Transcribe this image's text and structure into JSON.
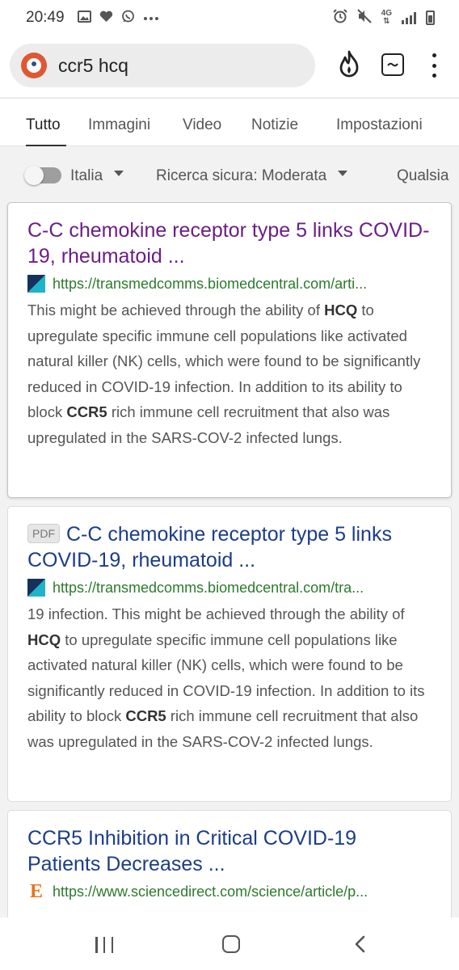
{
  "status_bar": {
    "time": "20:49",
    "network": "4G"
  },
  "search": {
    "query": "ccr5 hcq"
  },
  "tabs": [
    {
      "label": "Tutto",
      "active": true
    },
    {
      "label": "Immagini",
      "active": false
    },
    {
      "label": "Video",
      "active": false
    },
    {
      "label": "Notizie",
      "active": false
    },
    {
      "label": "Impostazioni",
      "active": false
    }
  ],
  "filters": {
    "region_label": "Italia",
    "safe_search_label": "Ricerca sicura: Moderata",
    "time_label": "Qualsia"
  },
  "results": [
    {
      "title": "C-C chemokine receptor type 5 links COVID-19, rheumatoid ...",
      "url": "https://transmedcomms.biomedcentral.com/arti...",
      "favicon": "bmc-icon",
      "visited": true,
      "snippet_parts": [
        {
          "t": "This might be achieved through the ability of ",
          "b": false
        },
        {
          "t": "HCQ",
          "b": true
        },
        {
          "t": " to upregulate specific immune cell populations like activated natural killer (NK) cells, which were found to be significantly reduced in COVID-19 infection. In addition to its ability to block ",
          "b": false
        },
        {
          "t": "CCR5",
          "b": true
        },
        {
          "t": " rich immune cell recruitment that also was upregulated in the SARS-COV-2 infected lungs.",
          "b": false
        }
      ]
    },
    {
      "badge": "PDF",
      "title": "C-C chemokine receptor type 5 links COVID-19, rheumatoid ...",
      "url": "https://transmedcomms.biomedcentral.com/tra...",
      "favicon": "bmc-icon",
      "visited": false,
      "snippet_parts": [
        {
          "t": "19 infection. This might be achieved through the ability of ",
          "b": false
        },
        {
          "t": "HCQ",
          "b": true
        },
        {
          "t": " to upregulate specific immune cell populations like activated natural killer (NK) cells, which were found to be significantly reduced in COVID-19 infection. In addition to its ability to block ",
          "b": false
        },
        {
          "t": "CCR5",
          "b": true
        },
        {
          "t": " rich immune cell recruitment that also was upregulated in the SARS-COV-2 infected lungs.",
          "b": false
        }
      ]
    },
    {
      "title": "CCR5 Inhibition in Critical COVID-19 Patients Decreases ...",
      "url": "https://www.sciencedirect.com/science/article/p...",
      "favicon": "elsevier-icon",
      "favicon_letter": "E",
      "visited": false,
      "snippet_parts": []
    }
  ],
  "colors": {
    "link": "#1a3d8a",
    "visited_link": "#6b1e87",
    "url_green": "#2c7a2c",
    "ddg_orange": "#de5833"
  }
}
